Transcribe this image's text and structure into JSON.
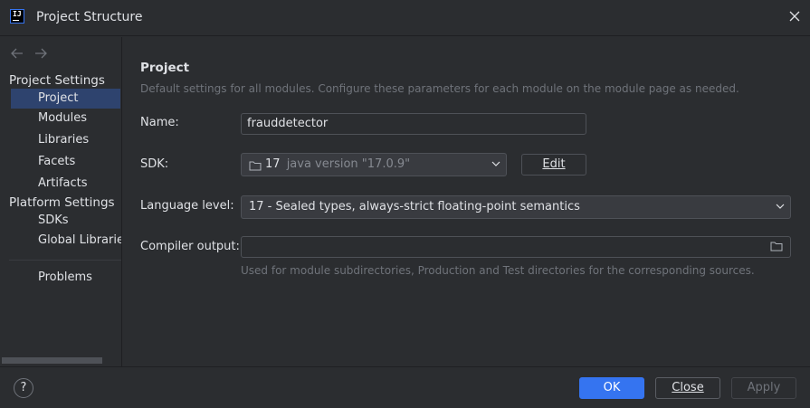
{
  "window": {
    "title": "Project Structure",
    "app_icon_text": "IJ"
  },
  "sidebar": {
    "back_icon": "arrow-left-icon",
    "forward_icon": "arrow-right-icon",
    "sections": [
      {
        "title": "Project Settings"
      },
      {
        "title": "Platform Settings"
      }
    ],
    "items": [
      {
        "label": "Project",
        "selected": true
      },
      {
        "label": "Modules"
      },
      {
        "label": "Libraries"
      },
      {
        "label": "Facets"
      },
      {
        "label": "Artifacts"
      },
      {
        "label": "SDKs"
      },
      {
        "label": "Global Libraries"
      },
      {
        "label": "Problems"
      }
    ]
  },
  "main": {
    "heading": "Project",
    "description": "Default settings for all modules. Configure these parameters for each module on the module page as needed.",
    "name_label": "Name:",
    "name_value": "frauddetector",
    "sdk_label": "SDK:",
    "sdk_version": "17",
    "sdk_detail": "java version \"17.0.9\"",
    "sdk_edit_label": "Edit",
    "language_label": "Language level:",
    "language_value": "17 - Sealed types, always-strict floating-point semantics",
    "compiler_label": "Compiler output:",
    "compiler_value": "",
    "compiler_hint": "Used for module subdirectories, Production and Test directories for the corresponding sources."
  },
  "footer": {
    "help_label": "?",
    "ok_label": "OK",
    "close_label": "Close",
    "apply_label": "Apply"
  },
  "colors": {
    "accent": "#3574f0",
    "selection": "#2e436e",
    "background": "#2b2d30"
  }
}
